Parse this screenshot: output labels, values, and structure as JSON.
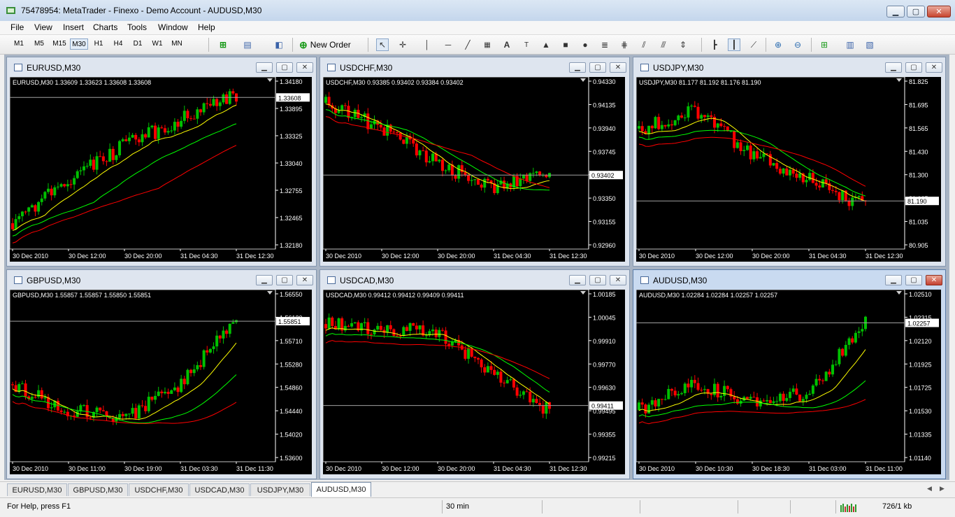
{
  "window": {
    "title": "75478954: MetaTrader - Finexo - Demo Account - AUDUSD,M30",
    "controls": {
      "minimize": "▁",
      "maximize": "▢",
      "close": "✕"
    }
  },
  "menu": [
    "File",
    "View",
    "Insert",
    "Charts",
    "Tools",
    "Window",
    "Help"
  ],
  "toolbar": {
    "timeframes": [
      "M1",
      "M5",
      "M15",
      "M30",
      "H1",
      "H4",
      "D1",
      "W1",
      "MN"
    ],
    "active_timeframe": "M30",
    "new_order_label": "New Order",
    "icons": [
      "new-chart-icon",
      "profiles-icon",
      "navigator-icon",
      "new-order-icon",
      "cursor-icon",
      "crosshair-icon",
      "vertical-line-icon",
      "horizontal-line-icon",
      "trendline-icon",
      "channel-icon",
      "text-icon",
      "text-label-icon",
      "triangle-icon",
      "rectangle-icon",
      "ellipse-icon",
      "fibonacci-icon",
      "gann-icon",
      "fibo-fan-icon",
      "arrows-icon",
      "bar-chart-icon",
      "candlestick-icon",
      "line-chart-icon",
      "zoom-in-icon",
      "zoom-out-icon",
      "indicators-icon",
      "period-icon",
      "templates-icon"
    ]
  },
  "charts": [
    {
      "id": "eurusd",
      "title": "EURUSD,M30",
      "info": "EURUSD,M30  1.33609 1.33623 1.33608 1.33608",
      "axis_prices": [
        "1.34180",
        "1.33895",
        "1.33325",
        "1.33040",
        "1.32755",
        "1.32465",
        "1.32180"
      ],
      "current_price": "1.33608",
      "time_labels": [
        "30 Dec 2010",
        "30 Dec 12:00",
        "30 Dec 20:00",
        "31 Dec 04:30",
        "31 Dec 12:30"
      ],
      "colors": {
        "up": "#00c000",
        "down": "#ff0000",
        "ma_fast": "#ffff00",
        "ma_mid": "#00ff00",
        "ma_slow": "#ff0000"
      }
    },
    {
      "id": "usdchf",
      "title": "USDCHF,M30",
      "info": "USDCHF,M30  0.93385 0.93402 0.93384 0.93402",
      "axis_prices": [
        "0.94330",
        "0.94135",
        "0.93940",
        "0.93745",
        "0.93545",
        "0.93350",
        "0.93155",
        "0.92960"
      ],
      "current_price": "0.93402",
      "time_labels": [
        "30 Dec 2010",
        "30 Dec 12:00",
        "30 Dec 20:00",
        "31 Dec 04:30",
        "31 Dec 12:30"
      ]
    },
    {
      "id": "usdjpy",
      "title": "USDJPY,M30",
      "info": "USDJPY,M30  81.177 81.192 81.176 81.190",
      "axis_prices": [
        "81.825",
        "81.695",
        "81.565",
        "81.430",
        "81.300",
        "81.165",
        "81.035",
        "80.905"
      ],
      "current_price": "81.190",
      "time_labels": [
        "30 Dec 2010",
        "30 Dec 12:00",
        "30 Dec 20:00",
        "31 Dec 04:30",
        "31 Dec 12:30"
      ]
    },
    {
      "id": "gbpusd",
      "title": "GBPUSD,M30",
      "info": "GBPUSD,M30  1.55857 1.55857 1.55850 1.55851",
      "axis_prices": [
        "1.56550",
        "1.56130",
        "1.55710",
        "1.55280",
        "1.54860",
        "1.54440",
        "1.54020",
        "1.53600"
      ],
      "current_price": "1.55851",
      "time_labels": [
        "30 Dec 2010",
        "30 Dec 11:00",
        "30 Dec 19:00",
        "31 Dec 03:30",
        "31 Dec 11:30"
      ]
    },
    {
      "id": "usdcad",
      "title": "USDCAD,M30",
      "info": "USDCAD,M30  0.99412 0.99412 0.99409 0.99411",
      "axis_prices": [
        "1.00185",
        "1.00045",
        "0.99910",
        "0.99770",
        "0.99630",
        "0.99495",
        "0.99355",
        "0.99215"
      ],
      "current_price": "0.99411",
      "time_labels": [
        "30 Dec 2010",
        "30 Dec 12:00",
        "30 Dec 20:00",
        "31 Dec 04:30",
        "31 Dec 12:30"
      ]
    },
    {
      "id": "audusd",
      "title": "AUDUSD,M30",
      "info": "AUDUSD,M30  1.02284 1.02284 1.02257 1.02257",
      "axis_prices": [
        "1.02510",
        "1.02315",
        "1.02120",
        "1.01925",
        "1.01725",
        "1.01530",
        "1.01335",
        "1.01140"
      ],
      "current_price": "1.02257",
      "time_labels": [
        "30 Dec 2010",
        "30 Dec 10:30",
        "30 Dec 18:30",
        "31 Dec 03:00",
        "31 Dec 11:00"
      ]
    }
  ],
  "chart_windows_controls": {
    "minimize": "▁",
    "maximize": "▢",
    "close": "✕"
  },
  "tabs": [
    "EURUSD,M30",
    "GBPUSD,M30",
    "USDCHF,M30",
    "USDCAD,M30",
    "USDJPY,M30",
    "AUDUSD,M30"
  ],
  "active_tab": "AUDUSD,M30",
  "status": {
    "help": "For Help, press F1",
    "period": "30 min",
    "traffic": "726/1 kb"
  }
}
